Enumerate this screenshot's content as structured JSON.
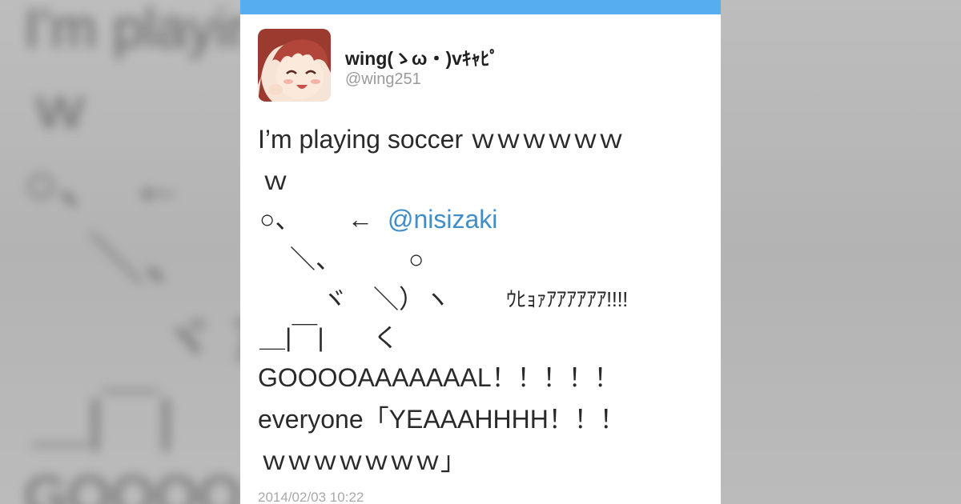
{
  "card": {
    "accent_color": "#56aef0",
    "avatar_icon": "anime-girl-avatar",
    "display_name": "wing(ゝω・)vｷｬﾋﾟ",
    "handle": "@wing251",
    "timestamp": "2014/02/03 10:22"
  },
  "tweet": {
    "line1": "I’m playing soccer ｗｗｗｗｗｗ",
    "line2": "ｗ",
    "line3_shape": "○、",
    "line3_arrow": "←",
    "line3_mention": "@nisizaki",
    "line4_left": "＼、",
    "line4_ball": "○",
    "line5_left": "ヾ　＼）ヽ",
    "line5_right": "ｳﾋｮｧｱｱｱｱｱｱ!!!!",
    "line6_left": "＿|￣|",
    "line6_right": "く",
    "line7": "GOOOOAAAAAAAL！！！！！",
    "line8": "everyone「YEAAAHHHH！！！",
    "line9": "ｗｗｗｗｗｗｗ」",
    "mention_color": "#3f8dc9"
  },
  "background": {
    "line1": "I'm playing soccer ｗｗｗ",
    "line2": "ｗ",
    "line3": "○、   ←",
    "line4": "＼、",
    "line5": "ヾ          ｱｱｱｱ!!",
    "line6": "＿|￣|",
    "line7": "GOOOO"
  }
}
